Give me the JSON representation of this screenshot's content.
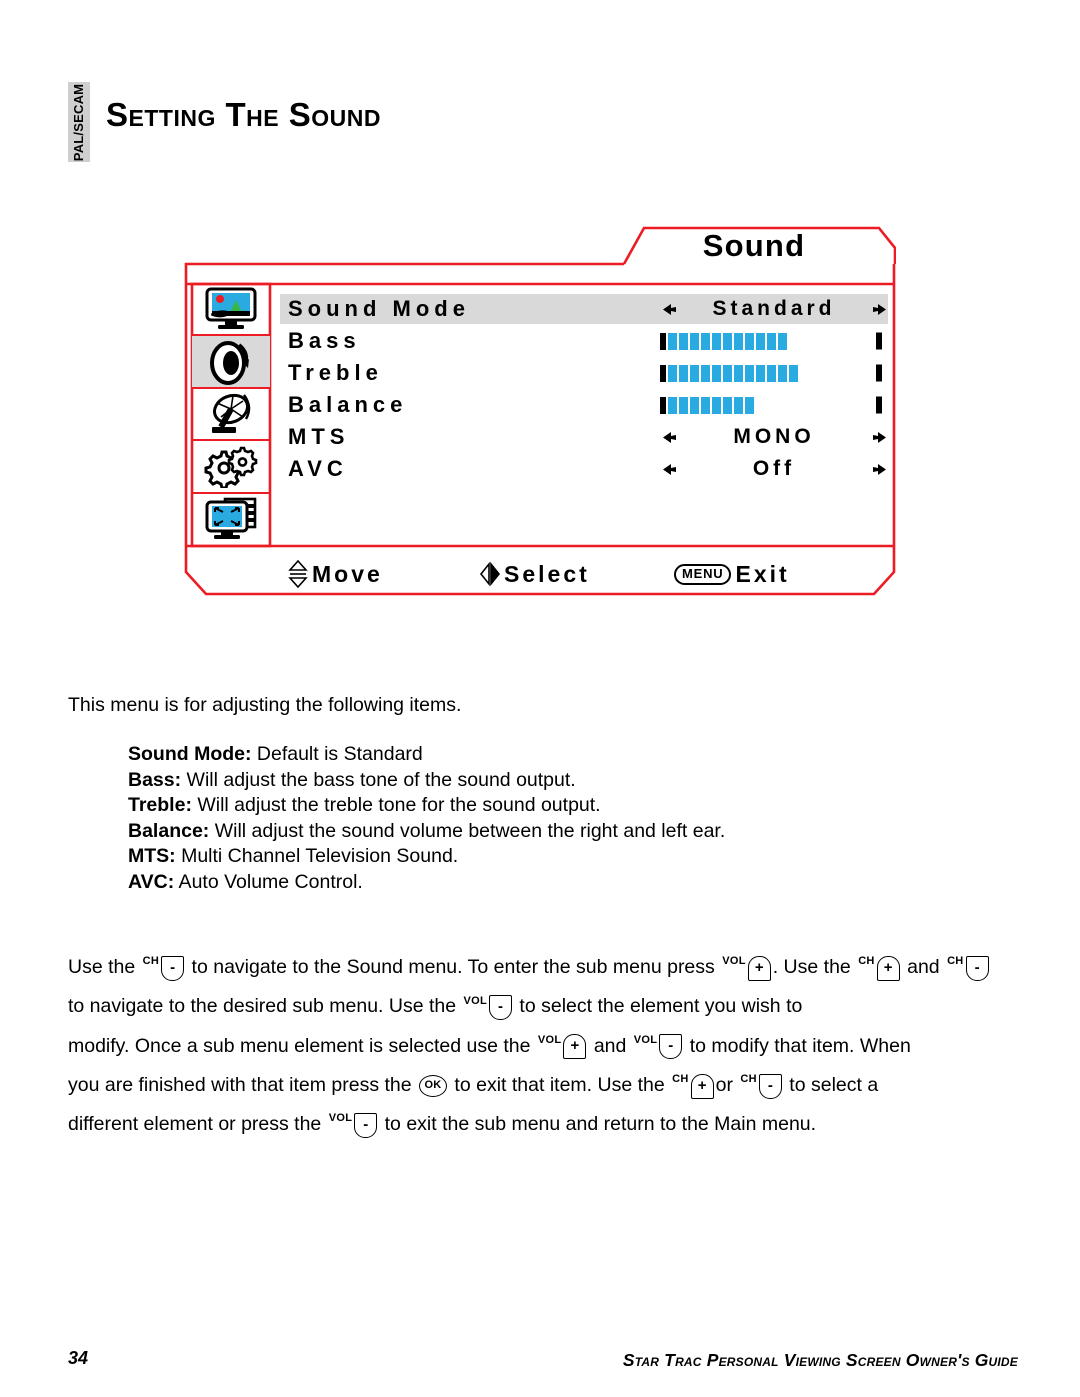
{
  "header": {
    "side_tab": "PAL/SECAM",
    "title": "Setting The Sound"
  },
  "osd": {
    "tab_title": "Sound",
    "colors": {
      "border_red": "#ED1C24",
      "bar_blue": "#29ABE2",
      "highlight_gray": "#d9d9d9"
    },
    "sidebar_icons": [
      {
        "name": "picture-icon",
        "active": false
      },
      {
        "name": "sound-speaker-icon",
        "active": true
      },
      {
        "name": "antenna-dish-icon",
        "active": false
      },
      {
        "name": "setup-gears-icon",
        "active": false
      },
      {
        "name": "screen-size-icon",
        "active": false
      }
    ],
    "rows": [
      {
        "label": "Sound Mode",
        "type": "option",
        "value": "Standard",
        "highlighted": true
      },
      {
        "label": "Bass",
        "type": "bar",
        "segments": 11,
        "highlighted": false
      },
      {
        "label": "Treble",
        "type": "bar",
        "segments": 12,
        "highlighted": false
      },
      {
        "label": "Balance",
        "type": "bar",
        "segments": 8,
        "highlighted": false
      },
      {
        "label": "MTS",
        "type": "option",
        "value": "MONO",
        "highlighted": false
      },
      {
        "label": "AVC",
        "type": "option",
        "value": "Off",
        "highlighted": false
      }
    ],
    "hints": [
      {
        "glyph": "up-down-arrow-icon",
        "label": "Move"
      },
      {
        "glyph": "left-right-arrow-icon",
        "label": "Select"
      },
      {
        "glyph": "menu-button-icon",
        "label": "Exit",
        "button_text": "MENU"
      }
    ]
  },
  "body": {
    "intro": "This menu is for adjusting the following items.",
    "definitions": [
      {
        "term": "Sound Mode:",
        "desc": " Default is Standard"
      },
      {
        "term": "Bass:",
        "desc": " Will adjust the bass tone of the sound output."
      },
      {
        "term": "Treble:",
        "desc": " Will adjust the treble tone for the sound output."
      },
      {
        "term": "Balance:",
        "desc": " Will adjust the sound volume between the right and left ear."
      },
      {
        "term": "MTS:",
        "desc": " Multi Channel Television Sound."
      },
      {
        "term": "AVC:",
        "desc": " Auto Volume Control."
      }
    ]
  },
  "instructions": {
    "t1": "Use the ",
    "t2": " to navigate to the Sound menu.  To enter the sub menu press ",
    "t3": ".  Use the ",
    "t4": "and ",
    "t5": " to navigate to the desired sub menu.  Use the ",
    "t6": " to select the element you wish to ",
    "t7": "modify.  Once a sub menu element is selected use the ",
    "t8": " and ",
    "t9": " to modify that item. When ",
    "t10": "you are finished with that item press the ",
    "t11": " to exit that item.  Use the ",
    "t12": "or ",
    "t13": " to select a ",
    "t14": "different element or press the ",
    "t15": " to exit the sub menu and return to the Main menu.",
    "keys": {
      "ch": "CH",
      "vol": "VOL",
      "plus": "+",
      "minus": "-",
      "ok": "OK"
    }
  },
  "page_footer": {
    "page_number": "34",
    "guide_title": "Star Trac Personal Viewing Screen Owner's Guide"
  }
}
